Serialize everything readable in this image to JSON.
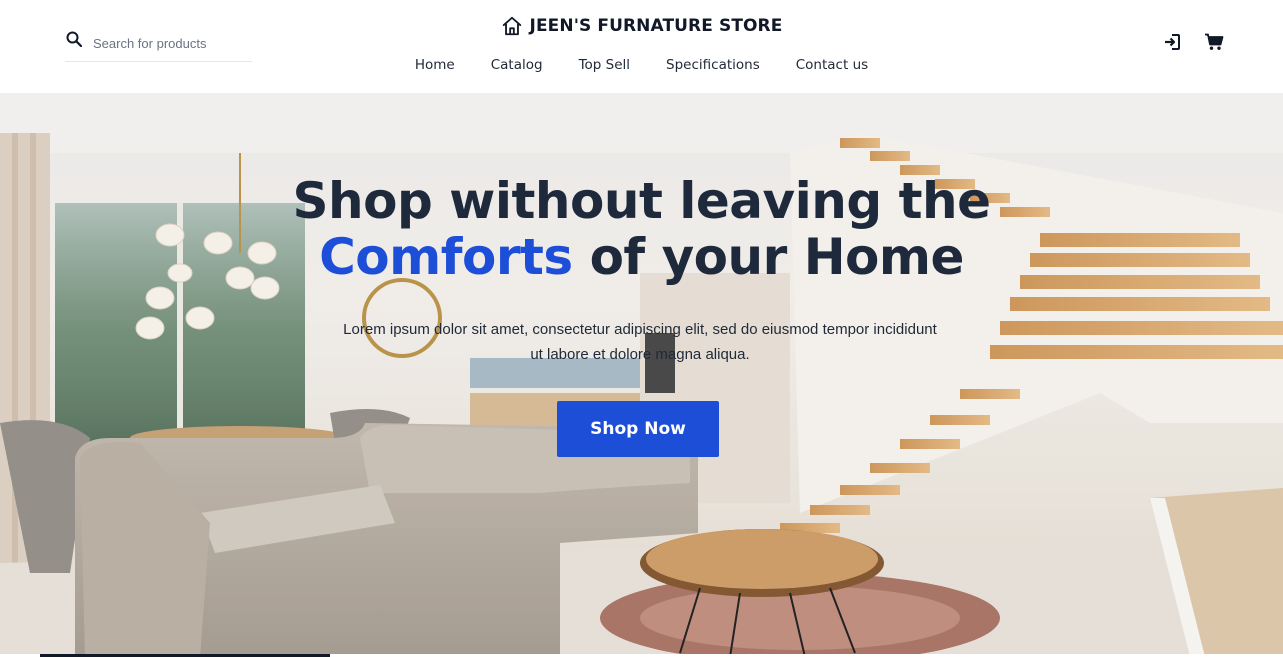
{
  "header": {
    "search": {
      "placeholder": "Search for products",
      "value": ""
    },
    "brand": {
      "name": "JEEN'S FURNATURE STORE",
      "icon": "home-icon"
    },
    "nav": [
      {
        "label": "Home"
      },
      {
        "label": "Catalog"
      },
      {
        "label": "Top Sell"
      },
      {
        "label": "Specifications"
      },
      {
        "label": "Contact us"
      }
    ],
    "actions": [
      {
        "icon": "sign-in-icon"
      },
      {
        "icon": "cart-icon"
      }
    ]
  },
  "hero": {
    "headline_line1": "Shop without leaving the",
    "headline_accent": "Comforts",
    "headline_rest": " of your Home",
    "lede": "Lorem ipsum dolor sit amet, consectetur adipiscing elit, sed do eiusmod tempor incididunt ut labore et dolore magna aliqua.",
    "cta": "Shop Now"
  },
  "colors": {
    "accent": "#1d4ed8",
    "headline": "#1e293b"
  }
}
